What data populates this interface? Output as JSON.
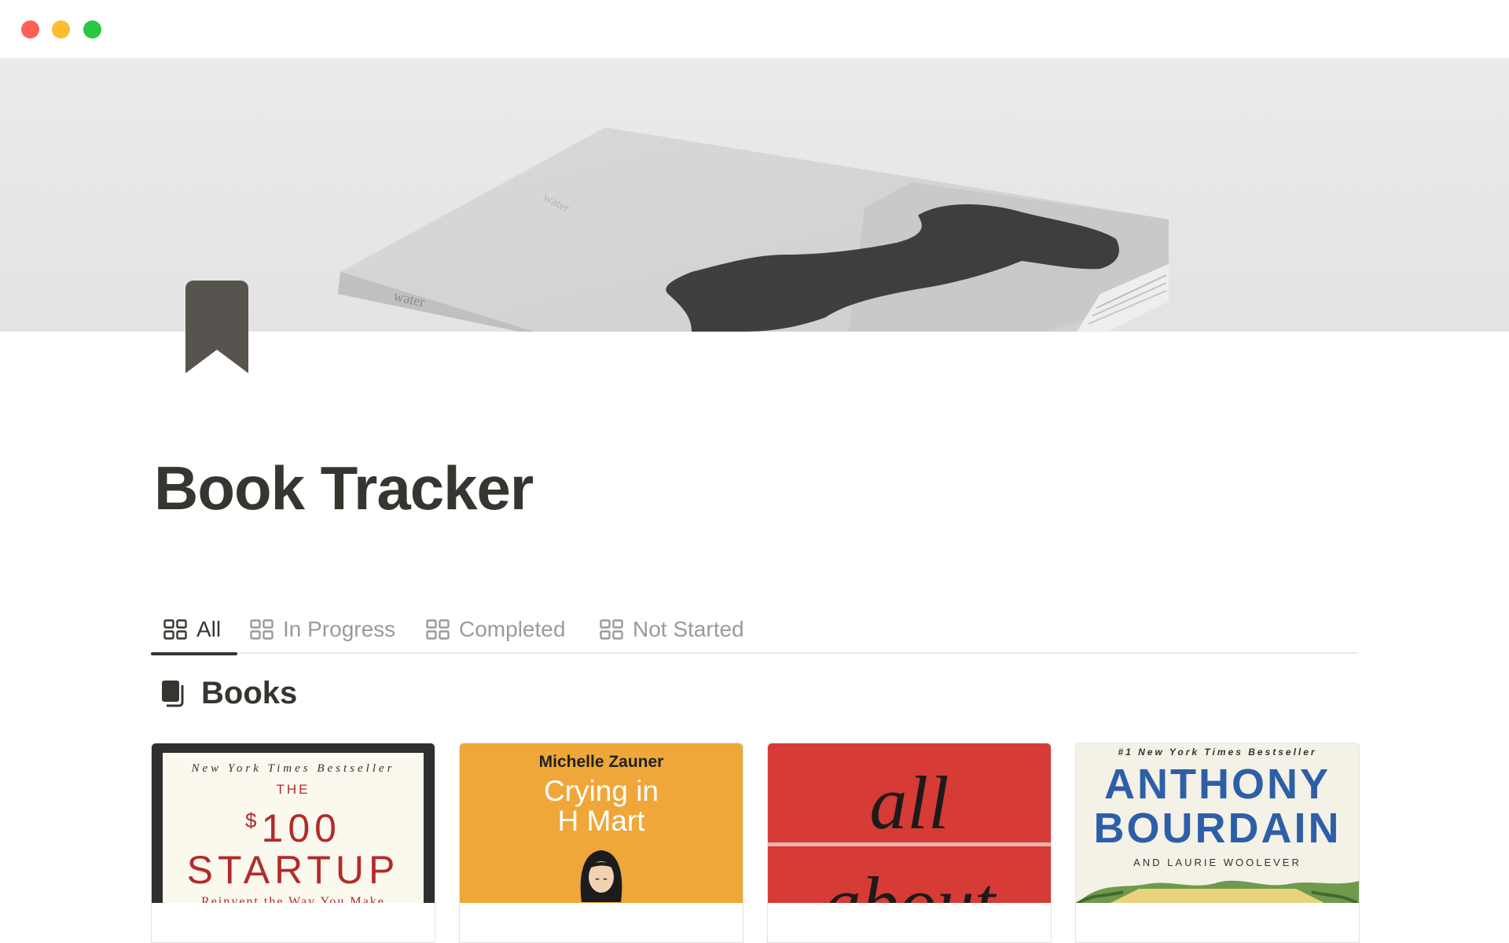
{
  "window": {
    "controls": [
      "close",
      "minimize",
      "zoom"
    ]
  },
  "cover": {
    "book_spine_text": "water",
    "book_cover_text": "water"
  },
  "page": {
    "icon": "bookmark-icon",
    "title": "Book Tracker"
  },
  "tabs": [
    {
      "label": "All",
      "icon": "gallery-icon",
      "active": true
    },
    {
      "label": "In Progress",
      "icon": "gallery-icon",
      "active": false
    },
    {
      "label": "Completed",
      "icon": "gallery-icon",
      "active": false
    },
    {
      "label": "Not Started",
      "icon": "gallery-icon",
      "active": false
    }
  ],
  "database": {
    "icon": "books-icon",
    "title": "Books"
  },
  "books": [
    {
      "cover_lines": {
        "header": "New York Times Bestseller",
        "the": "THE",
        "currency": "$",
        "number": "100",
        "title": "STARTUP",
        "subtitle": "Reinvent the Way You Make"
      }
    },
    {
      "cover_lines": {
        "author": "Michelle Zauner",
        "title_line_1": "Crying in",
        "title_line_2": "H Mart"
      }
    },
    {
      "cover_lines": {
        "word_1": "all",
        "word_2": "about"
      }
    },
    {
      "cover_lines": {
        "header": "#1 New York Times Bestseller",
        "name_1": "ANTHONY",
        "name_2": "BOURDAIN",
        "coauthor": "AND LAURIE WOOLEVER"
      }
    }
  ],
  "colors": {
    "text": "#37352f",
    "muted": "#9b9a97",
    "divider": "#e9e9e7",
    "close": "#fe5f57",
    "minimize": "#febc2e",
    "zoom": "#28c840"
  }
}
